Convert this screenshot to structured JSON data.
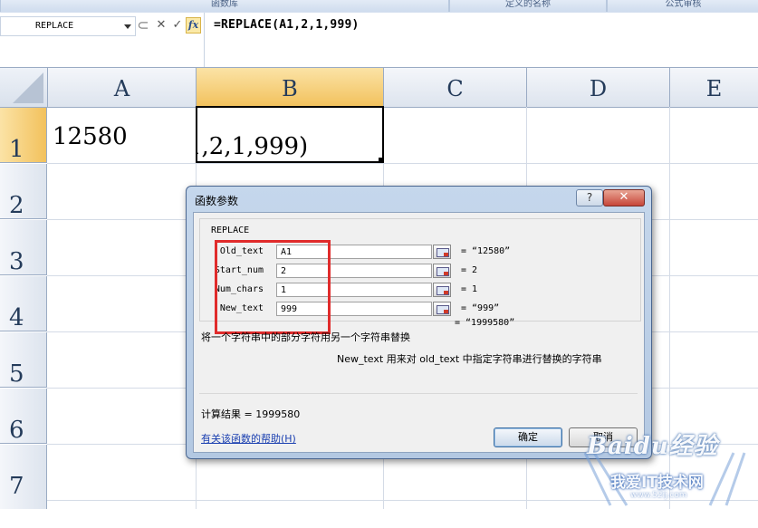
{
  "ribbon": {
    "groups": [
      "函数库",
      "定义的名称",
      "公式审核"
    ]
  },
  "formula_bar": {
    "name_box": "REPLACE",
    "cancel_glyph": "✕",
    "enter_glyph": "✓",
    "fx_glyph": "fx",
    "formula": "=REPLACE(A1,2,1,999)"
  },
  "sheet": {
    "columns": [
      "A",
      "B",
      "C",
      "D",
      "E"
    ],
    "rows": [
      "1",
      "2",
      "3",
      "4",
      "5",
      "6",
      "7"
    ],
    "cells": {
      "A1": "12580",
      "B1": "1,2,1,999)"
    }
  },
  "dialog": {
    "title": "函数参数",
    "help_glyph": "?",
    "close_glyph": "✕",
    "function_name": "REPLACE",
    "params": [
      {
        "label": "Old_text",
        "value": "A1",
        "result": "= “12580”"
      },
      {
        "label": "Start_num",
        "value": "2",
        "result": "= 2"
      },
      {
        "label": "Num_chars",
        "value": "1",
        "result": "= 1"
      },
      {
        "label": "New_text",
        "value": "999",
        "result": "= “999”"
      }
    ],
    "total_result": "= “1999580”",
    "description": "将一个字符串中的部分字符用另一个字符串替换",
    "param_description": "New_text  用来对 old_text 中指定字符串进行替换的字符串",
    "calc_result": "计算结果 =  1999580",
    "help_link": "有关该函数的帮助(H)",
    "ok_label": "确定",
    "cancel_label": "取消"
  },
  "watermark": {
    "line1": "Baidu经验",
    "line2": "我爱IT技术网",
    "line3": "www.52ij.com"
  }
}
